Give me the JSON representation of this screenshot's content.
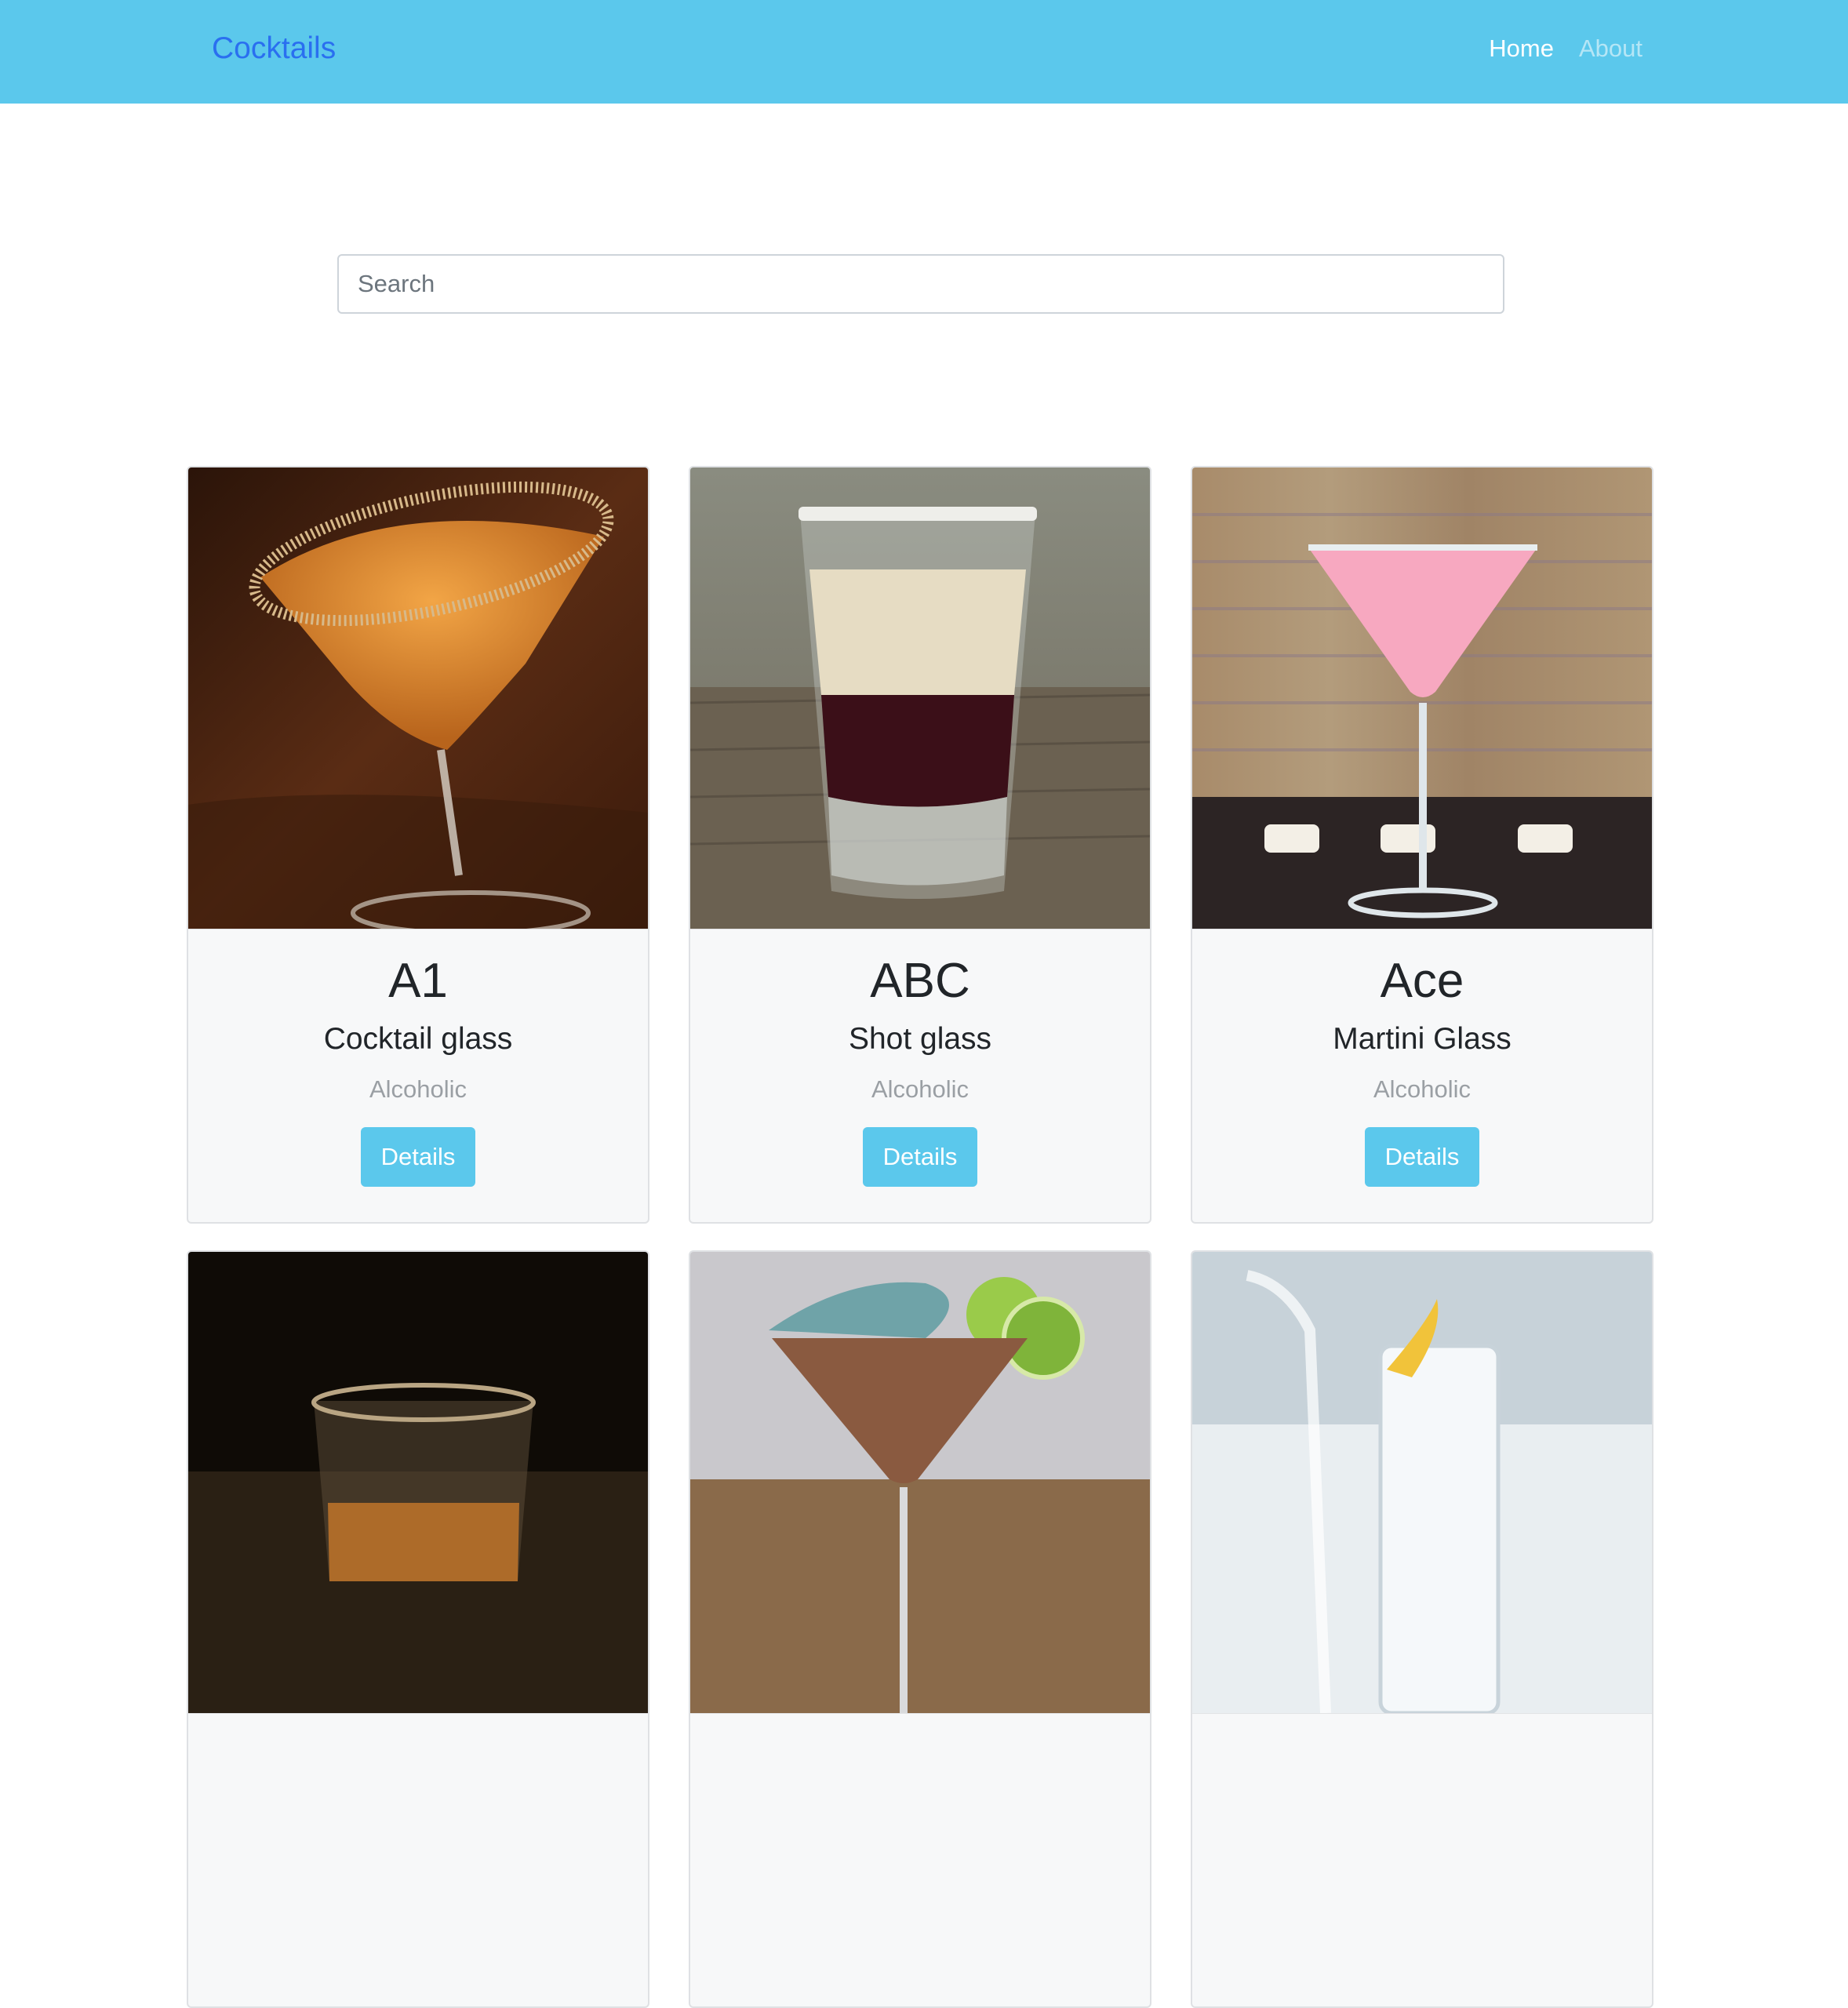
{
  "navbar": {
    "brand": "Cocktails",
    "links": [
      {
        "label": "Home",
        "active": true
      },
      {
        "label": "About",
        "active": false
      }
    ],
    "background": "#5bc8ec"
  },
  "search": {
    "placeholder": "Search",
    "value": ""
  },
  "cards": [
    {
      "name": "A1",
      "glass": "Cocktail glass",
      "category": "Alcoholic",
      "button": "Details"
    },
    {
      "name": "ABC",
      "glass": "Shot glass",
      "category": "Alcoholic",
      "button": "Details"
    },
    {
      "name": "Ace",
      "glass": "Martini Glass",
      "category": "Alcoholic",
      "button": "Details"
    }
  ],
  "colors": {
    "accent": "#5bc8ec",
    "brand_link": "#2a6ff0",
    "muted_text": "#9a9fa4"
  }
}
